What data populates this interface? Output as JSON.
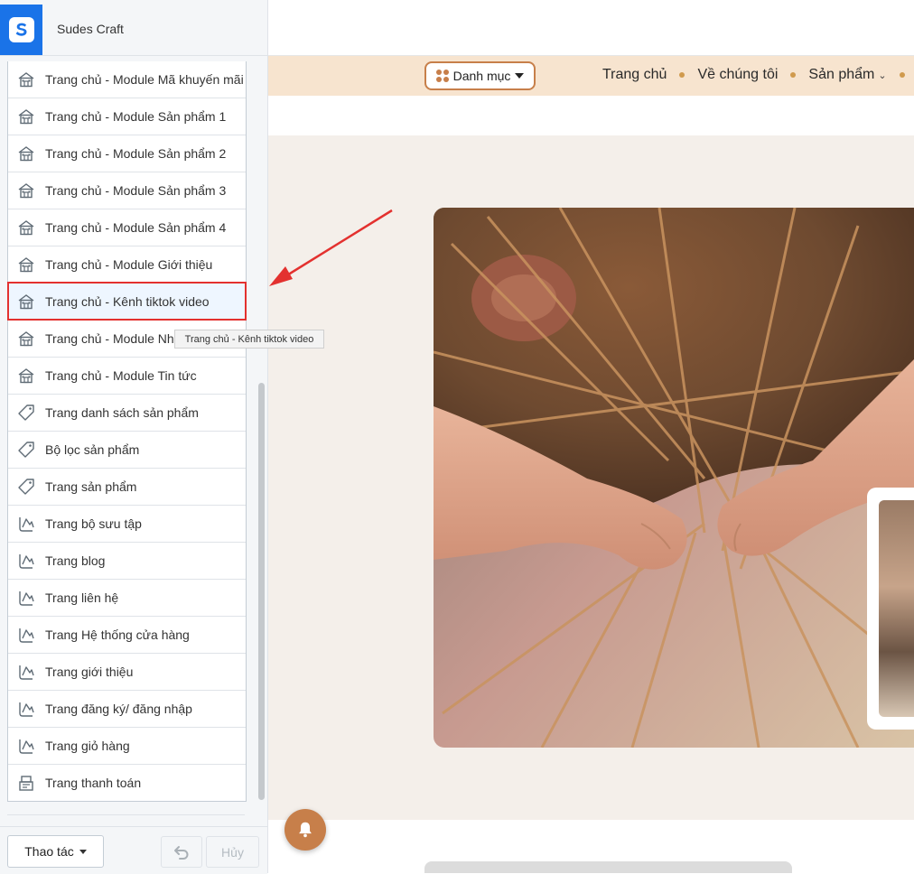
{
  "header": {
    "shop_name": "Sudes Craft",
    "logo_letter": "S",
    "logo_color": "#1a73e8"
  },
  "sidebar": {
    "items": [
      {
        "label": "Trang chủ - Module Mã khuyến mãi",
        "icon": "home-icon"
      },
      {
        "label": "Trang chủ - Module Sản phẩm 1",
        "icon": "home-icon"
      },
      {
        "label": "Trang chủ - Module Sản phẩm 2",
        "icon": "home-icon"
      },
      {
        "label": "Trang chủ - Module Sản phẩm 3",
        "icon": "home-icon"
      },
      {
        "label": "Trang chủ - Module Sản phẩm 4",
        "icon": "home-icon"
      },
      {
        "label": "Trang chủ - Module Giới thiệu",
        "icon": "home-icon"
      },
      {
        "label": "Trang chủ - Kênh tiktok video",
        "icon": "home-icon",
        "active": true
      },
      {
        "label": "Trang chủ - Module Nhận xét",
        "icon": "home-icon"
      },
      {
        "label": "Trang chủ - Module Tin tức",
        "icon": "home-icon"
      },
      {
        "label": "Trang danh sách sản phẩm",
        "icon": "tag-icon"
      },
      {
        "label": "Bộ lọc sản phẩm",
        "icon": "tag-icon"
      },
      {
        "label": "Trang sản phẩm",
        "icon": "tag-icon"
      },
      {
        "label": "Trang bộ sưu tập",
        "icon": "pages-icon"
      },
      {
        "label": "Trang blog",
        "icon": "pages-icon"
      },
      {
        "label": "Trang liên hệ",
        "icon": "pages-icon"
      },
      {
        "label": "Trang Hệ thống cửa hàng",
        "icon": "pages-icon"
      },
      {
        "label": "Trang giới thiệu",
        "icon": "pages-icon"
      },
      {
        "label": "Trang đăng ký/ đăng nhập",
        "icon": "pages-icon"
      },
      {
        "label": "Trang giỏ hàng",
        "icon": "pages-icon"
      },
      {
        "label": "Trang thanh toán",
        "icon": "register-icon"
      }
    ],
    "tooltip": "Trang chủ - Kênh tiktok video",
    "highlight_color": "#e3312f"
  },
  "footer": {
    "actions_label": "Thao tác",
    "cancel_label": "Hủy"
  },
  "preview": {
    "category_button": "Danh mục",
    "nav": [
      "Trang chủ",
      "Về chúng tôi",
      "Sản phẩm"
    ],
    "accent_color": "#c77f4a",
    "nav_bg_color": "#f7e4cf"
  }
}
